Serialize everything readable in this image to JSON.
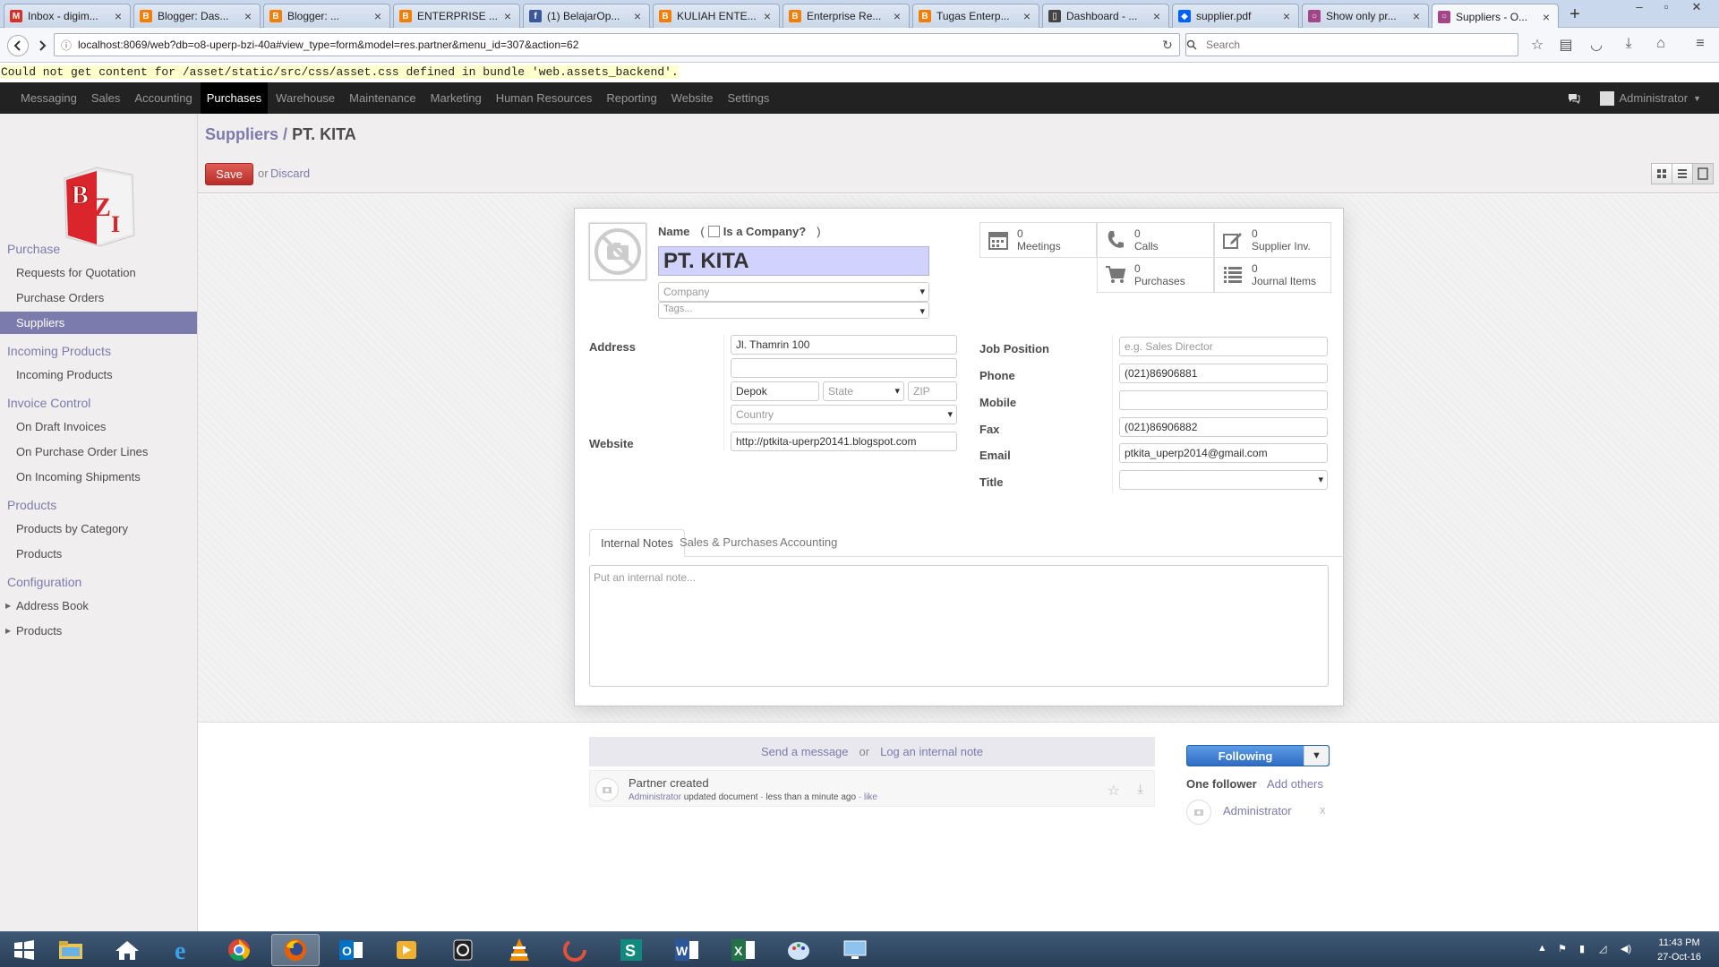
{
  "browser": {
    "tabs": [
      {
        "title": "Inbox - digim...",
        "favicon": "gmail-icon",
        "color": "#d93025"
      },
      {
        "title": "Blogger: Das...",
        "favicon": "blogger-icon",
        "color": "#f57d00"
      },
      {
        "title": "Blogger: ...",
        "favicon": "blogger-icon",
        "color": "#f57d00"
      },
      {
        "title": "ENTERPRISE ...",
        "favicon": "blogger-icon",
        "color": "#f57d00"
      },
      {
        "title": "(1) BelajarOp...",
        "favicon": "facebook-icon",
        "color": "#3b5998"
      },
      {
        "title": "KULIAH ENTE...",
        "favicon": "blogger-icon",
        "color": "#f57d00"
      },
      {
        "title": "Enterprise Re...",
        "favicon": "blogger-icon",
        "color": "#f57d00"
      },
      {
        "title": "Tugas Enterp...",
        "favicon": "blogger-icon",
        "color": "#f57d00"
      },
      {
        "title": "Dashboard - ...",
        "favicon": "document-icon",
        "color": "#444444"
      },
      {
        "title": "supplier.pdf",
        "favicon": "dropbox-icon",
        "color": "#0061ff"
      },
      {
        "title": "Show only pr...",
        "favicon": "odoo-icon",
        "color": "#a24689"
      },
      {
        "title": "Suppliers - O...",
        "favicon": "odoo-icon",
        "color": "#a24689"
      }
    ],
    "url": "localhost:8069/web?db=o8-uperp-bzi-40a#view_type=form&model=res.partner&menu_id=307&action=62",
    "search_placeholder": "Search"
  },
  "error_message": "Could not get content for /asset/static/src/css/asset.css defined in bundle 'web.assets_backend'.",
  "top_menu": {
    "items": [
      "Messaging",
      "Sales",
      "Accounting",
      "Purchases",
      "Warehouse",
      "Maintenance",
      "Marketing",
      "Human Resources",
      "Reporting",
      "Website",
      "Settings"
    ],
    "active": "Purchases",
    "user": "Administrator"
  },
  "sidebar": {
    "sections": [
      {
        "title": "Purchase",
        "items": [
          "Requests for Quotation",
          "Purchase Orders",
          "Suppliers"
        ]
      },
      {
        "title": "Incoming Products",
        "items": [
          "Incoming Products"
        ]
      },
      {
        "title": "Invoice Control",
        "items": [
          "On Draft Invoices",
          "On Purchase Order Lines",
          "On Incoming Shipments"
        ]
      },
      {
        "title": "Products",
        "items": [
          "Products by Category",
          "Products"
        ]
      },
      {
        "title": "Configuration",
        "items": [
          "Address Book",
          "Products"
        ]
      }
    ],
    "active_item": "Suppliers"
  },
  "breadcrumb": {
    "parent": "Suppliers",
    "sep": "/",
    "current": "PT. KITA"
  },
  "actions": {
    "save": "Save",
    "or": "or",
    "discard": "Discard"
  },
  "form": {
    "name_label": "Name",
    "is_company_label": "Is a Company?",
    "name_value": "PT. KITA",
    "company_placeholder": "Company",
    "tags_placeholder": "Tags...",
    "stat_buttons": [
      {
        "count": "0",
        "label": "Meetings",
        "icon": "calendar-icon"
      },
      {
        "count": "0",
        "label": "Calls",
        "icon": "phone-icon"
      },
      {
        "count": "0",
        "label": "Supplier Inv.",
        "icon": "edit-icon"
      },
      {
        "count": "0",
        "label": "Purchases",
        "icon": "cart-icon"
      },
      {
        "count": "0",
        "label": "Journal Items",
        "icon": "list-icon"
      }
    ],
    "address_label": "Address",
    "street": "Jl. Thamrin 100",
    "street2": "",
    "city": "Depok",
    "state_placeholder": "State",
    "zip_placeholder": "ZIP",
    "country_placeholder": "Country",
    "website_label": "Website",
    "website": "http://ptkita-uperp20141.blogspot.com",
    "job_position_label": "Job Position",
    "job_position_placeholder": "e.g. Sales Director",
    "phone_label": "Phone",
    "phone": "(021)86906881",
    "mobile_label": "Mobile",
    "mobile": "",
    "fax_label": "Fax",
    "fax": "(021)86906882",
    "email_label": "Email",
    "email": "ptkita_uperp2014@gmail.com",
    "title_label": "Title",
    "notebook_tabs": [
      "Internal Notes",
      "Sales & Purchases",
      "Accounting"
    ],
    "active_tab": "Internal Notes",
    "note_placeholder": "Put an internal note..."
  },
  "chatter": {
    "send_message": "Send a message",
    "or": "or",
    "log_note": "Log an internal note",
    "message_title": "Partner created",
    "message_author": "Administrator",
    "message_body": "updated document",
    "message_time": "less than a minute ago",
    "message_like": "like",
    "following_label": "Following",
    "followers_label": "One follower",
    "add_others": "Add others",
    "follower_name": "Administrator",
    "remove": "x"
  },
  "taskbar": {
    "time": "11:43 PM",
    "date": "27-Oct-16"
  },
  "colors": {
    "accent": "#7c7bad",
    "save_button": "#d9534f",
    "topbar": "#222222",
    "following": "#3a7bd5"
  }
}
